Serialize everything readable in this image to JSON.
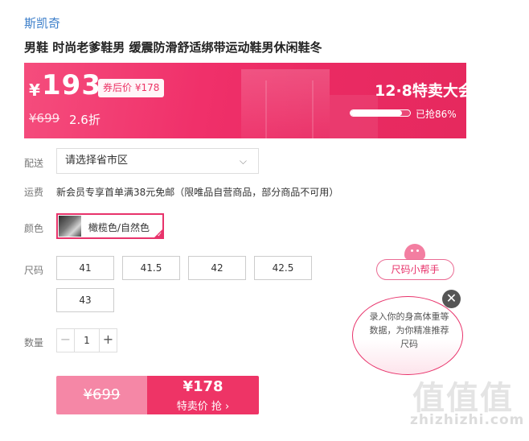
{
  "product": {
    "brand": "斯凯奇",
    "title": "男鞋 时尚老爹鞋男 缓震防滑舒适绑带运动鞋男休闲鞋冬"
  },
  "banner": {
    "currency": "¥",
    "price": "193",
    "coupon_label": "券后价 ¥178",
    "original_price": "¥699",
    "discount": "2.6折",
    "event_title": "12·8特卖大会",
    "progress_fraction": 0.86,
    "progress_text": "已抢86%"
  },
  "shipping": {
    "deliver_label": "配送",
    "region_placeholder": "请选择省市区",
    "fee_label": "运费",
    "fee_text": "新会员专享首单满38元免邮（限唯品自营商品，部分商品不可用）"
  },
  "color": {
    "label": "颜色",
    "selected": "橄榄色/自然色"
  },
  "size": {
    "label": "尺码",
    "options": [
      "41",
      "41.5",
      "42",
      "42.5",
      "43"
    ]
  },
  "quantity": {
    "label": "数量",
    "minus": "−",
    "value": "1",
    "plus": "+"
  },
  "buy": {
    "original_price": "¥699",
    "sale_price": "¥178",
    "action": "特卖价 抢 ›"
  },
  "helper": {
    "tag": "尺码小帮手",
    "bubble_text": "录入你的身高体重等数据，为你精准推荐尺码",
    "close": "✕"
  },
  "watermark": {
    "logo_text": "值值值",
    "site": "zhizhizhi.com"
  },
  "colors": {
    "accent": "#ee3466",
    "brand_link": "#3a7dc9"
  }
}
